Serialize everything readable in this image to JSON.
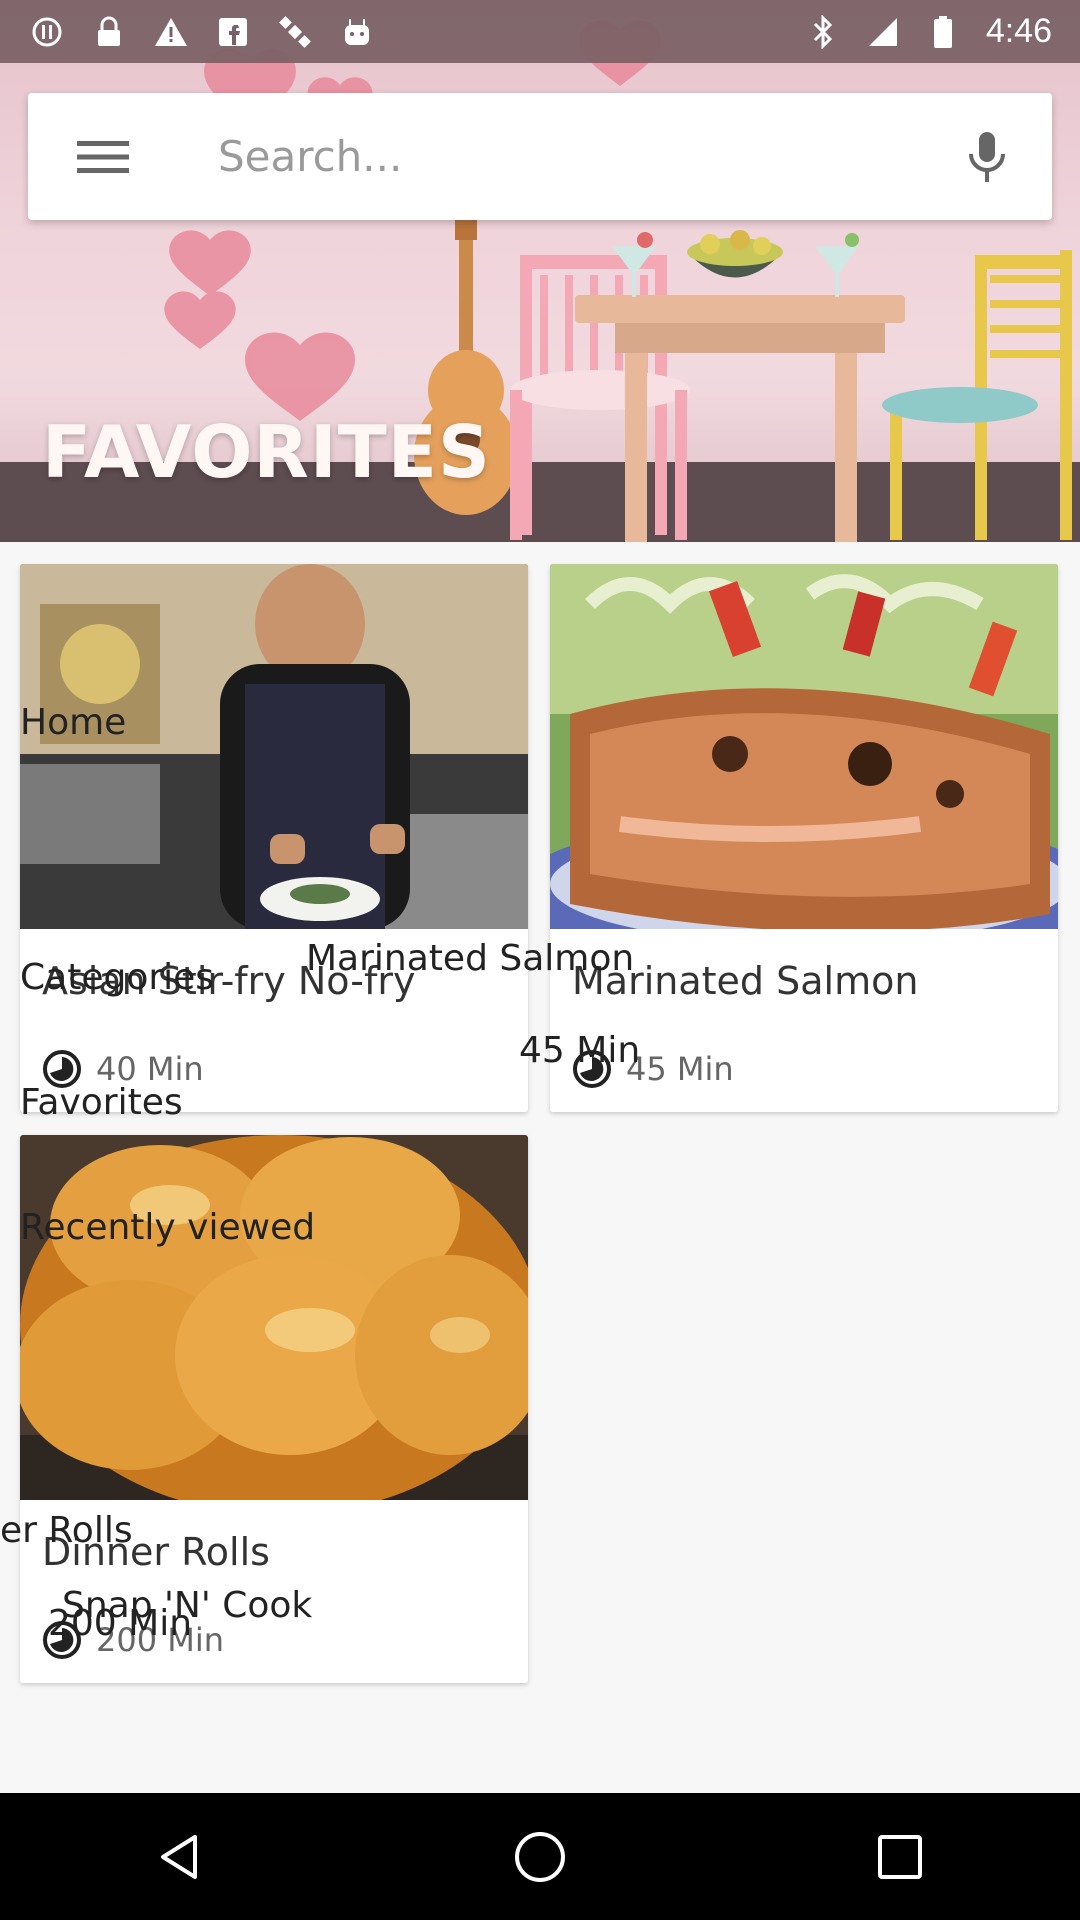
{
  "status_bar": {
    "time": "4:46",
    "icons": [
      "notification-icon",
      "lock-icon",
      "warning-icon",
      "facebook-icon",
      "satellite-icon",
      "android-icon",
      "bluetooth-icon",
      "signal-icon",
      "battery-icon"
    ]
  },
  "search": {
    "placeholder": "Search...",
    "menu_icon": "hamburger-menu-icon",
    "mic_icon": "microphone-icon"
  },
  "hero": {
    "title": "FAVORITES"
  },
  "recipes": [
    {
      "title": "Asian Stir-fry No-fry",
      "time": "40 Min",
      "image": "chef-cooking"
    },
    {
      "title": "Marinated Salmon",
      "time": "45 Min",
      "image": "salmon-plate"
    },
    {
      "title": "Dinner Rolls",
      "time": "200 Min",
      "image": "dinner-rolls"
    }
  ],
  "ghost_overlay": {
    "home": "Home",
    "categories": "Categories",
    "favorites": "Favorites",
    "recently_viewed": "Recently viewed",
    "salmon_title": "Marinated Salmon",
    "salmon_time": "45 Min",
    "rolls_title": "er Rolls",
    "rolls_time": "200 Min",
    "app_name": "Snap 'N' Cook"
  },
  "nav": {
    "back_icon": "back-icon",
    "home_icon": "home-icon",
    "recents_icon": "recents-icon"
  },
  "colors": {
    "status_bar": "#78606a",
    "card_bg": "#ffffff",
    "page_bg": "#f7f7f7",
    "nav_bg": "#000000"
  }
}
